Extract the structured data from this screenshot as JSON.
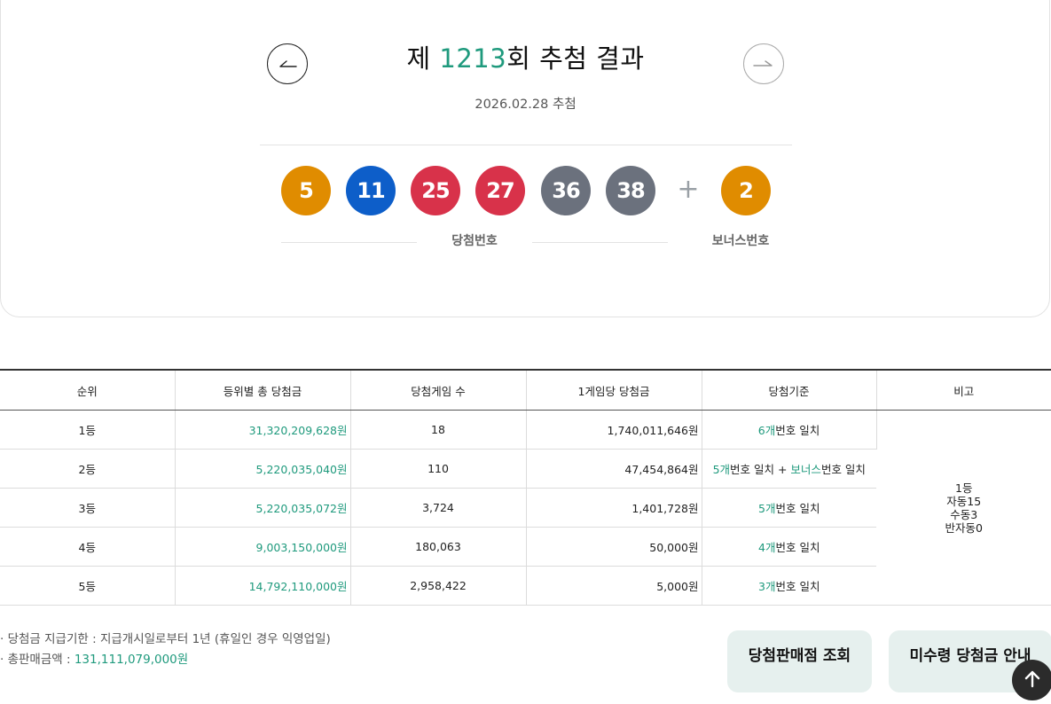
{
  "draw": {
    "title_prefix": "제 ",
    "round": "1213",
    "title_suffix": "회 추첨 결과",
    "date": "2026.02.28 추첨",
    "prev_icon": "arrow-left-icon",
    "next_icon": "arrow-right-icon"
  },
  "balls": {
    "winning": [
      {
        "number": "5",
        "color": "#e08c00"
      },
      {
        "number": "11",
        "color": "#0d5ec9"
      },
      {
        "number": "25",
        "color": "#d8324a"
      },
      {
        "number": "27",
        "color": "#d8324a"
      },
      {
        "number": "36",
        "color": "#6b717d"
      },
      {
        "number": "38",
        "color": "#6b717d"
      }
    ],
    "plus": "+",
    "bonus": {
      "number": "2",
      "color": "#e08c00"
    },
    "winning_label": "당첨번호",
    "bonus_label": "보너스번호"
  },
  "table": {
    "headers": [
      "순위",
      "등위별 총 당첨금",
      "당첨게임 수",
      "1게임당 당첨금",
      "당첨기준",
      "비고"
    ],
    "rows": [
      {
        "rank": "1등",
        "total": "31,320,209,628원",
        "games": "18",
        "per_game": "1,740,011,646원",
        "criteria": [
          {
            "t": "6개",
            "g": true
          },
          {
            "t": "번호 일치",
            "g": false
          }
        ]
      },
      {
        "rank": "2등",
        "total": "5,220,035,040원",
        "games": "110",
        "per_game": "47,454,864원",
        "criteria": [
          {
            "t": "5개",
            "g": true
          },
          {
            "t": "번호 일치 + ",
            "g": false
          },
          {
            "t": "보너스",
            "g": true
          },
          {
            "t": "번호 일치",
            "g": false
          }
        ]
      },
      {
        "rank": "3등",
        "total": "5,220,035,072원",
        "games": "3,724",
        "per_game": "1,401,728원",
        "criteria": [
          {
            "t": "5개",
            "g": true
          },
          {
            "t": "번호 일치",
            "g": false
          }
        ]
      },
      {
        "rank": "4등",
        "total": "9,003,150,000원",
        "games": "180,063",
        "per_game": "50,000원",
        "criteria": [
          {
            "t": "4개",
            "g": true
          },
          {
            "t": "번호 일치",
            "g": false
          }
        ]
      },
      {
        "rank": "5등",
        "total": "14,792,110,000원",
        "games": "2,958,422",
        "per_game": "5,000원",
        "criteria": [
          {
            "t": "3개",
            "g": true
          },
          {
            "t": "번호 일치",
            "g": false
          }
        ]
      }
    ],
    "note_lines": [
      "1등",
      "자동15",
      "수동3",
      "반자동0"
    ]
  },
  "footer": {
    "deadline": "·  당첨금 지급기한 : 지급개시일로부터 1년 (휴일인 경우 익영업일)",
    "sales_label": "·  총판매금액 : ",
    "sales_value": "131,111,079,000원",
    "store_button": "당첨판매점 조회",
    "unclaimed_button": "미수령 당첨금 안내",
    "top_icon": "arrow-up-icon"
  },
  "colors": {
    "accent": "#1f9a7d",
    "button_bg": "#e6f0ee"
  }
}
